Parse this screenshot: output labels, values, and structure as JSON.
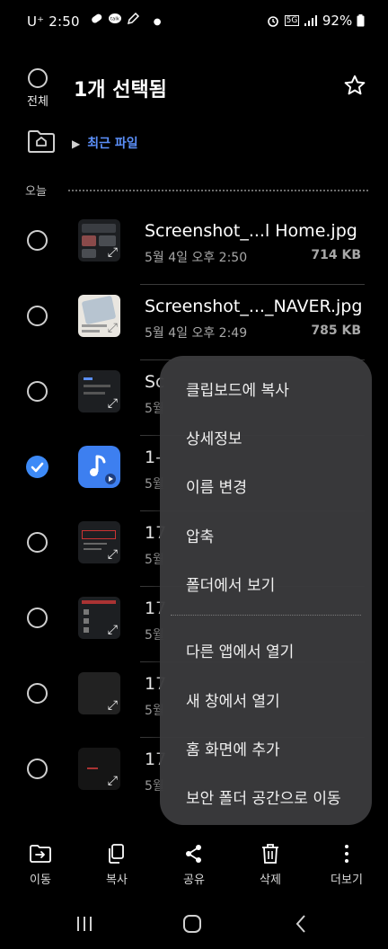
{
  "status_bar": {
    "carrier": "U⁺",
    "time": "2:50",
    "network": "5G",
    "battery": "92%"
  },
  "header": {
    "select_all_label": "전체",
    "title": "1개 선택됨"
  },
  "path": {
    "breadcrumb": "최근 파일"
  },
  "section": {
    "label": "오늘"
  },
  "files": [
    {
      "name": "Screenshot_...l Home.jpg",
      "date": "5월 4일 오후 2:50",
      "size": "714 KB",
      "thumb": "dark"
    },
    {
      "name": "Screenshot_..._NAVER.jpg",
      "date": "5월 4일 오후 2:49",
      "size": "785 KB",
      "thumb": "light"
    },
    {
      "name": "Sc",
      "date": "5월",
      "size": "",
      "thumb": "dark"
    },
    {
      "name": "1-",
      "date": "5월",
      "size": "",
      "thumb": "music",
      "selected": true
    },
    {
      "name": "17",
      "date": "5월",
      "size": "",
      "thumb": "dark"
    },
    {
      "name": "17",
      "date": "5월",
      "size": "",
      "thumb": "dark"
    },
    {
      "name": "17",
      "date": "5월",
      "size": "",
      "thumb": "dark"
    },
    {
      "name": "17",
      "date": "5월",
      "size": "",
      "thumb": "dark"
    }
  ],
  "context_menu": {
    "items": [
      "클립보드에 복사",
      "상세정보",
      "이름 변경",
      "압축",
      "폴더에서 보기",
      "다른 앱에서 열기",
      "새 창에서 열기",
      "홈 화면에 추가",
      "보안 폴더 공간으로 이동"
    ]
  },
  "bottom_bar": {
    "move": "이동",
    "copy": "복사",
    "share": "공유",
    "delete": "삭제",
    "more": "더보기"
  },
  "colors": {
    "accent": "#5b8ff9",
    "checkbox_selected": "#3d8af7",
    "menu_bg": "#3a3a3c"
  }
}
